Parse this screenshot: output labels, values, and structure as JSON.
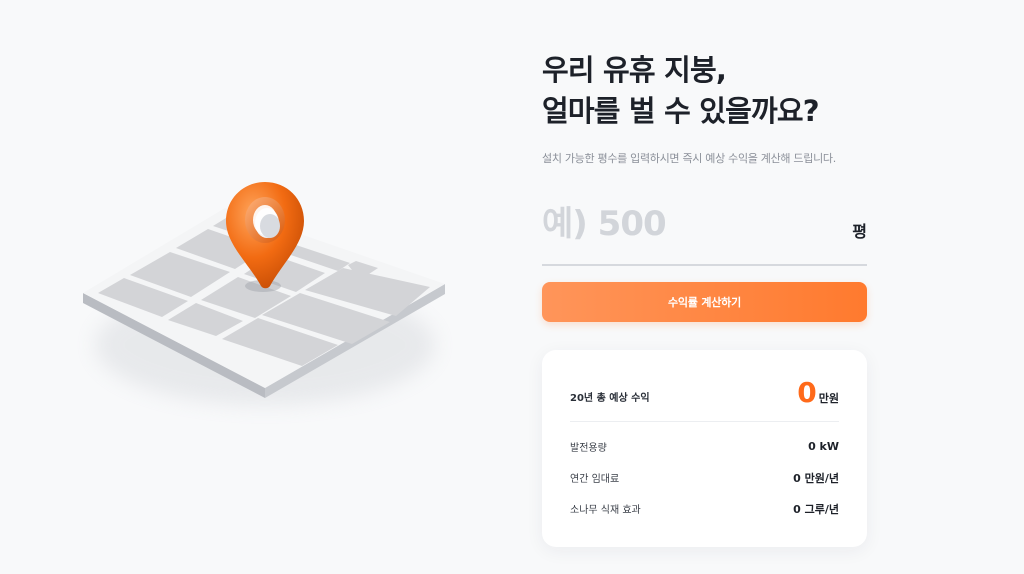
{
  "hero": {
    "headline_line1": "우리 유휴 지붕,",
    "headline_line2": "얼마를 벌 수 있을까요?",
    "subtext": "설치 가능한 평수를 입력하시면 즉시 예상 수익을 계산해 드립니다."
  },
  "area_input": {
    "placeholder": "예) 500",
    "value": "",
    "unit": "평"
  },
  "calculate_button": {
    "label": "수익률 계산하기"
  },
  "results": {
    "total": {
      "label": "20년 총 예상 수익",
      "value": "0",
      "unit": "만원"
    },
    "stats": [
      {
        "label": "발전용량",
        "value": "0 kW"
      },
      {
        "label": "연간 임대료",
        "value": "0 만원/년"
      },
      {
        "label": "소나무 식재 효과",
        "value": "0 그루/년"
      }
    ]
  },
  "illustration": {
    "icon": "map-pin-icon",
    "pin_color": "#f26b12",
    "map_color": "#d3d4d7"
  },
  "colors": {
    "accent": "#ff7a2e",
    "accent_light": "#ff955a",
    "background": "#f8f9fa",
    "text": "#1d2129",
    "muted": "#8b9099"
  }
}
